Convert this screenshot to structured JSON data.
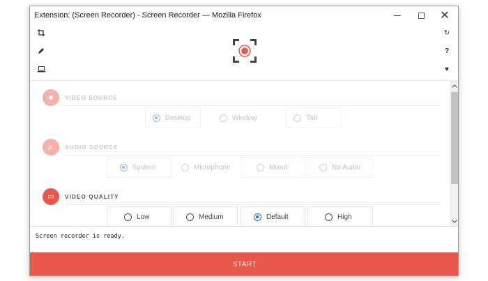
{
  "window": {
    "title": "Extension: (Screen Recorder) - Screen Recorder — Mozilla Firefox",
    "minimize_icon": "minimize-icon",
    "maximize_icon": "maximize-icon",
    "close_glyph": "✕"
  },
  "toolbar": {
    "left_icons": [
      "crop-icon",
      "pencil-icon",
      "laptop-icon"
    ],
    "right_icons": [
      "refresh-icon",
      "help-icon",
      "heart-icon"
    ],
    "glyphs": {
      "refresh": "↻",
      "help": "?",
      "heart": "♥"
    }
  },
  "colors": {
    "accent": "#e8574b",
    "radio_selected": "#1f6fbf",
    "disabled_text": "#c2c2c2"
  },
  "sections": [
    {
      "label": "VIDEO SOURCE",
      "icon": "video-camera-icon",
      "glyph": "■",
      "active": false,
      "options": [
        {
          "label": "Desktop",
          "checked": true
        },
        {
          "label": "Window",
          "checked": false
        },
        {
          "label": "Tab",
          "checked": false
        }
      ]
    },
    {
      "label": "AUDIO SOURCE",
      "icon": "music-note-icon",
      "glyph": "♬",
      "active": false,
      "options": [
        {
          "label": "System",
          "checked": true
        },
        {
          "label": "Microphone",
          "checked": false
        },
        {
          "label": "Mixed",
          "checked": false
        },
        {
          "label": "No Audio",
          "checked": false
        }
      ]
    },
    {
      "label": "VIDEO QUALITY",
      "icon": "monitor-icon",
      "glyph": "▭",
      "active": true,
      "options": [
        {
          "label": "Low",
          "checked": false
        },
        {
          "label": "Medium",
          "checked": false
        },
        {
          "label": "Default",
          "checked": true
        },
        {
          "label": "High",
          "checked": false
        }
      ]
    }
  ],
  "status": {
    "text": "Screen recorder is ready."
  },
  "start_button": {
    "label": "START"
  }
}
